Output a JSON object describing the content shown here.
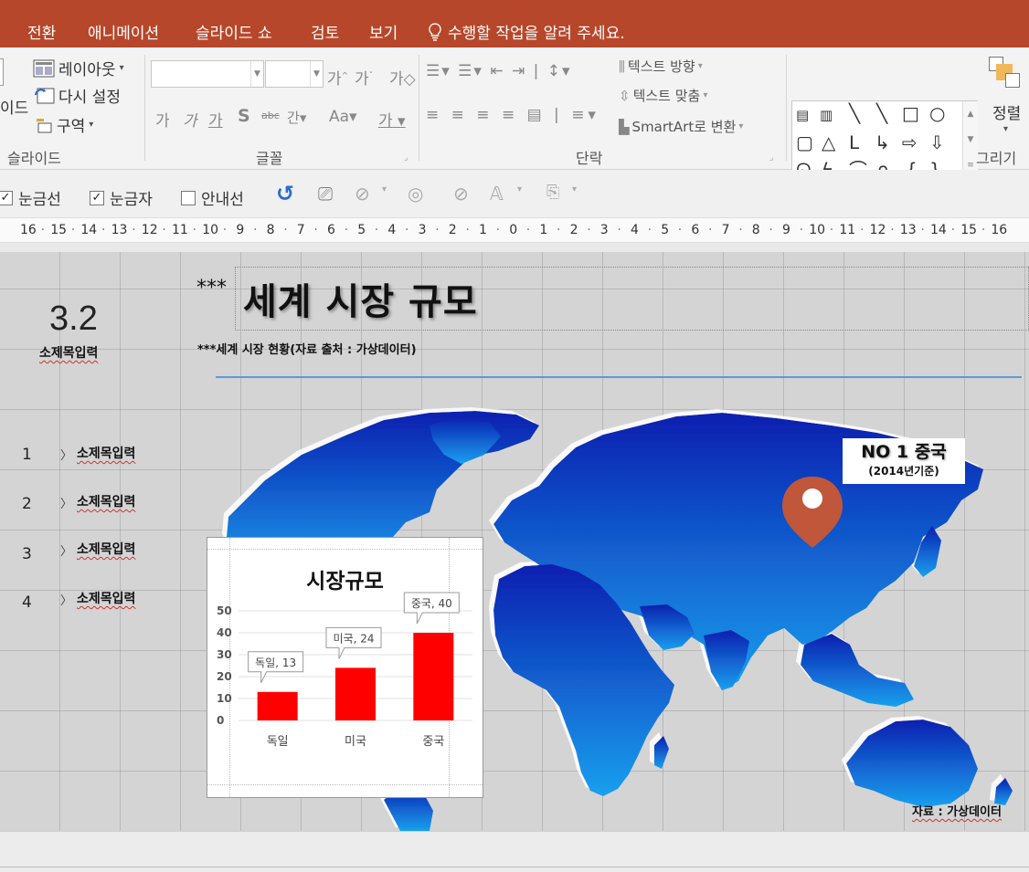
{
  "menu": {
    "tabs": [
      "전환",
      "애니메이션",
      "슬라이드 쇼",
      "검토",
      "보기"
    ],
    "tell_me": "수행할 작업을 알려 주세요."
  },
  "ribbon": {
    "slides": {
      "layout": "레이아웃",
      "reset": "다시 설정",
      "section": "구역",
      "left_cut": "이드",
      "group": "슬라이드"
    },
    "font": {
      "group": "글꼴",
      "grow": "가",
      "shrink": "가",
      "clear": "가",
      "bold": "가",
      "italic": "가",
      "underline": "가",
      "shadow": "S",
      "strike": "abc",
      "spacing": "간",
      "case": "Aa",
      "color": "가"
    },
    "paragraph": {
      "group": "단락",
      "text_direction": "텍스트 방향",
      "align_text": "텍스트 맞춤",
      "smartart": "SmartArt로 변환"
    },
    "drawing": {
      "group": "그리기",
      "arrange": "정렬"
    }
  },
  "viewbar": {
    "gridlines": "눈금선",
    "ruler": "눈금자",
    "guides": "안내선"
  },
  "ruler_ticks": [
    "16",
    "15",
    "14",
    "13",
    "12",
    "11",
    "10",
    "9",
    "8",
    "7",
    "6",
    "5",
    "4",
    "3",
    "2",
    "1",
    "0",
    "1",
    "2",
    "3",
    "4",
    "5",
    "6",
    "7",
    "8",
    "9",
    "10",
    "11",
    "12",
    "13",
    "14",
    "15",
    "16"
  ],
  "slide": {
    "section_number": "3.2",
    "section_label": "소제목입력",
    "stars": "***",
    "title": "세계 시장 규모",
    "subtitle": "***세계 시장 현황(자료 출처 : 가상데이터)",
    "list": [
      {
        "num": "1",
        "label": "소제목입력"
      },
      {
        "num": "2",
        "label": "소제목입력"
      },
      {
        "num": "3",
        "label": "소제목입력"
      },
      {
        "num": "4",
        "label": "소제목입력"
      }
    ],
    "callout_line1": "NO 1 중국",
    "callout_line2": "(2014년기준)",
    "source": "자료 : 가상데이터",
    "map_color_top": "#0a1fb0",
    "map_color_bottom": "#1aa0ee",
    "pin_color": "#c0573a"
  },
  "chart_data": {
    "type": "bar",
    "title": "시장규모",
    "categories": [
      "독일",
      "미국",
      "중국"
    ],
    "values": [
      13,
      24,
      40
    ],
    "data_labels": [
      "독일, 13",
      "미국, 24",
      "중국, 40"
    ],
    "ylim": [
      0,
      50
    ],
    "yticks": [
      0,
      10,
      20,
      30,
      40,
      50
    ],
    "bar_color": "#ff0000"
  }
}
